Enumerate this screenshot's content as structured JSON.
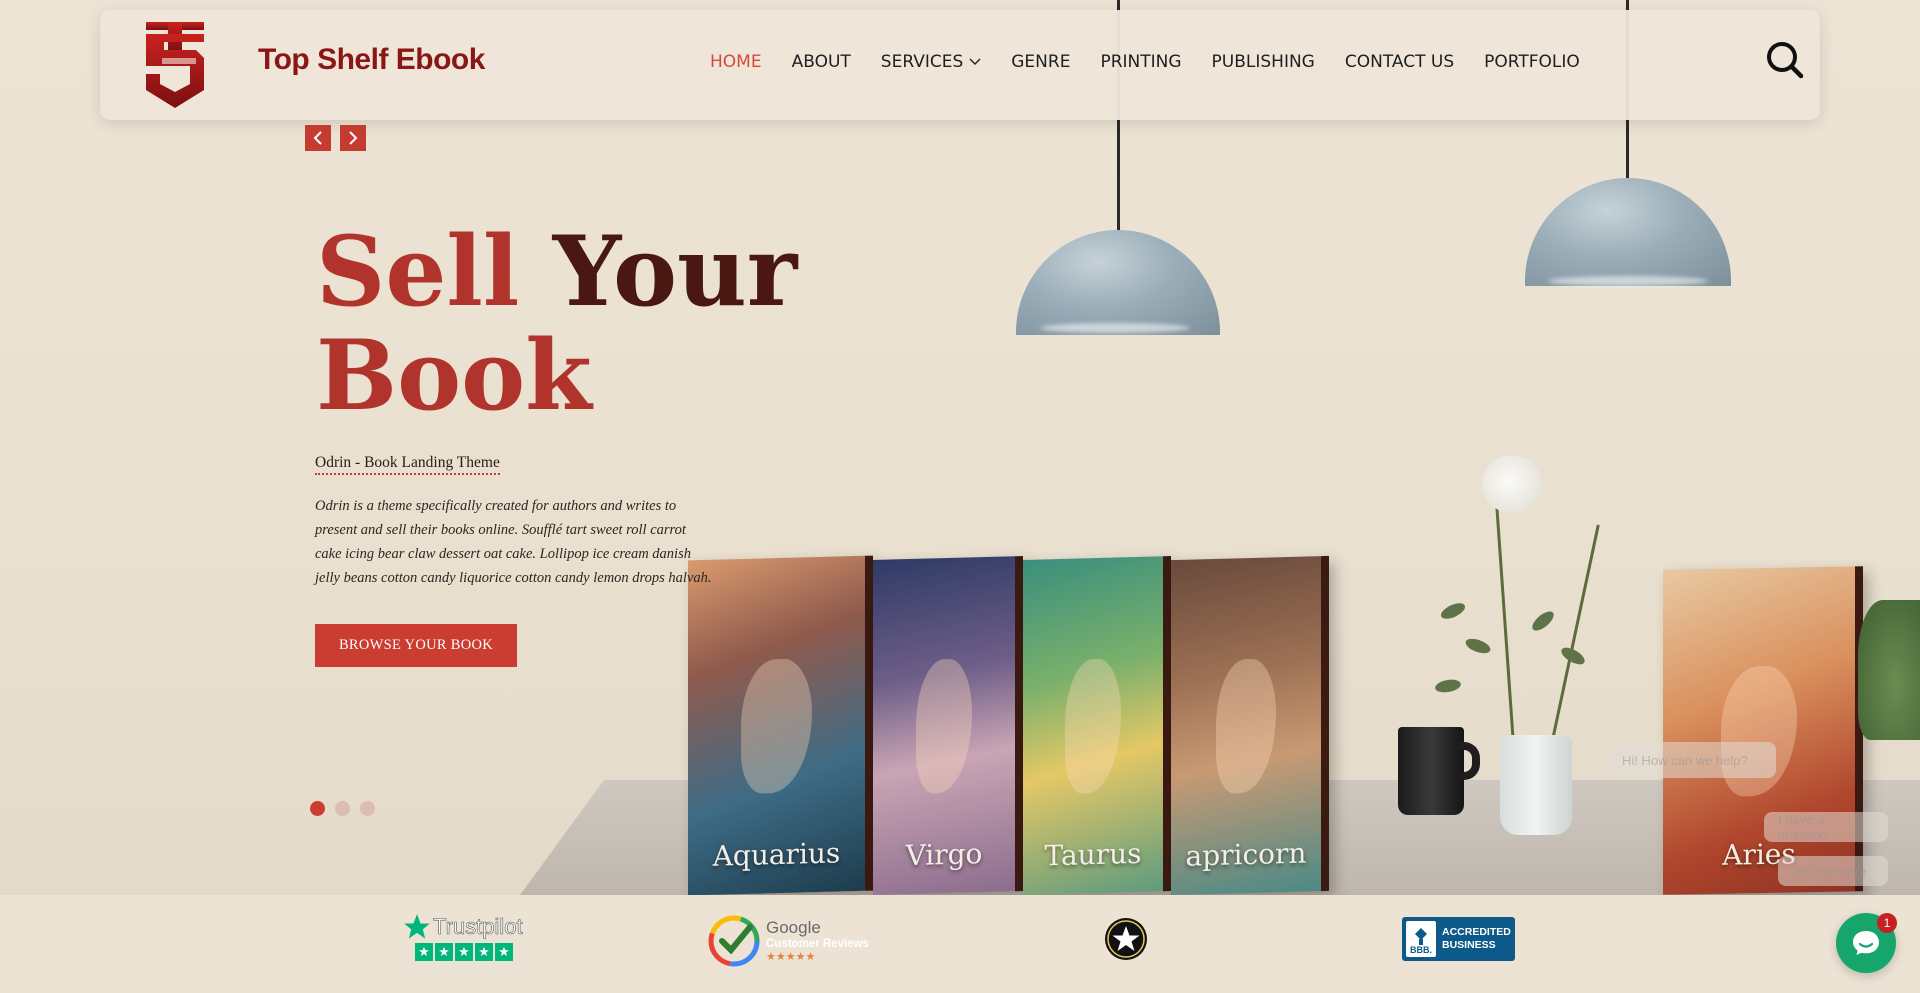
{
  "brand": {
    "name": "Top Shelf Ebook",
    "accent": "#8a1616"
  },
  "nav": {
    "items": [
      {
        "label": "HOME",
        "active": true
      },
      {
        "label": "ABOUT"
      },
      {
        "label": "SERVICES",
        "has_dropdown": true
      },
      {
        "label": "GENRE"
      },
      {
        "label": "PRINTING"
      },
      {
        "label": "PUBLISHING"
      },
      {
        "label": "CONTACT US"
      },
      {
        "label": "PORTFOLIO"
      }
    ],
    "search_icon": "search-icon"
  },
  "hero": {
    "title_word1": "Sell",
    "title_word2": "Your",
    "title_word3": "Book",
    "subtitle": "Odrin - Book Landing Theme",
    "description": "Odrin is a theme specifically created for authors and writes to present and sell their books online. Soufflé tart sweet roll carrot cake icing bear claw dessert oat cake. Lollipop ice cream danish jelly beans cotton candy liquorice cotton candy lemon drops halvah.",
    "cta_label": "BROWSE YOUR BOOK",
    "slides_count": 3,
    "active_slide": 1,
    "books": [
      {
        "title": "Aquarius"
      },
      {
        "title": "Virgo"
      },
      {
        "title": "Taurus"
      },
      {
        "title": "apricorn"
      },
      {
        "title": "Aries"
      }
    ]
  },
  "chat": {
    "greeting": "Hi! How can we help?",
    "quick_replies": [
      "I have a question",
      "Tell me more"
    ],
    "unread_count": "1"
  },
  "trust": {
    "trustpilot": "Trustpilot",
    "google_line1": "Google",
    "google_line2": "Customer Reviews",
    "google_stars": "★★★★★",
    "bbb_line1": "ACCREDITED",
    "bbb_line2": "BUSINESS",
    "bbb_logo": "BBB."
  },
  "colors": {
    "primary": "#cc3d31",
    "dark": "#4a1712",
    "chat": "#16a56a"
  }
}
